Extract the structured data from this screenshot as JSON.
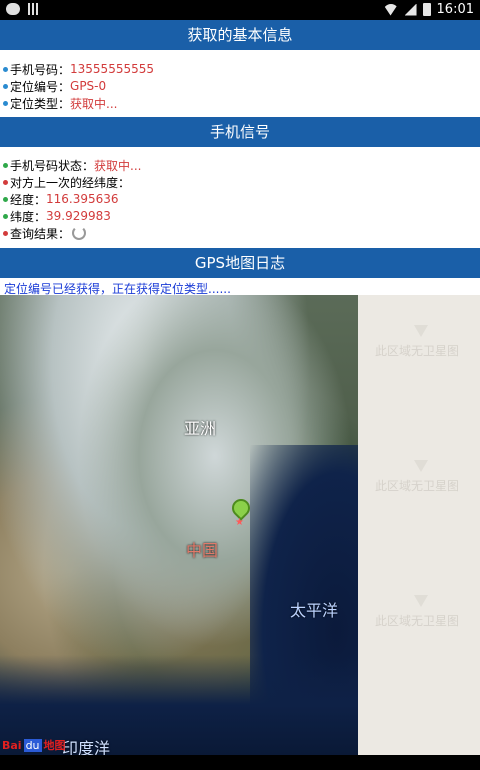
{
  "statusbar": {
    "time": "16:01"
  },
  "basic_info": {
    "title": "获取的基本信息",
    "phone_label": "手机号码：",
    "phone_value": "13555555555",
    "loc_id_label": "定位编号：",
    "loc_id_value": "GPS-0",
    "loc_type_label": "定位类型：",
    "loc_type_value": "获取中..."
  },
  "signal": {
    "title": "手机信号",
    "phone_status_label": "手机号码状态：",
    "phone_status_value": "获取中...",
    "last_coords_label": "对方上一次的经纬度：",
    "lng_label": "经度：",
    "lng_value": "116.395636",
    "lat_label": "纬度：",
    "lat_value": "39.929983",
    "query_label": "查询结果："
  },
  "gps_log": {
    "title": "GPS地图日志",
    "message": "定位编号已经获得，正在获得定位类型......"
  },
  "map": {
    "no_imagery_text": "此区域无卫星图",
    "labels": {
      "asia": "亚洲",
      "china": "中国",
      "pacific": "太平洋",
      "indian": "印度洋"
    },
    "logo": {
      "bai": "Bai",
      "du": "du",
      "ditu": "地图"
    }
  },
  "colors": {
    "header_bg": "#1a5fa8",
    "value_red": "#d23b3b",
    "log_blue": "#1a3bd6"
  }
}
